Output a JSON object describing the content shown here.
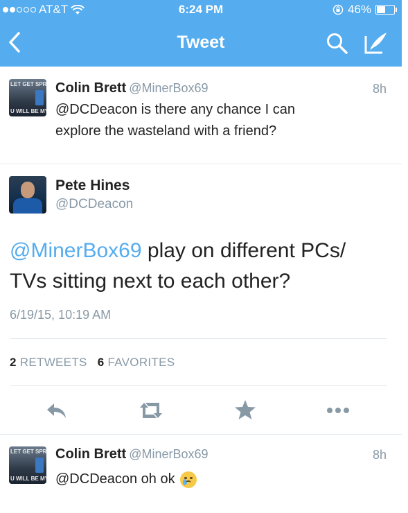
{
  "status_bar": {
    "carrier": "AT&T",
    "time": "6:24 PM",
    "battery": "46%"
  },
  "nav": {
    "title": "Tweet",
    "back_icon": "chevron-left-icon",
    "search_icon": "search-icon",
    "compose_icon": "compose-icon"
  },
  "reply_above": {
    "name": "Colin Brett",
    "handle": "@MinerBox69",
    "time": "8h",
    "text_line1": "@DCDeacon is there any chance I can",
    "text_line2": "explore the wasteland with a friend?",
    "avatar_text_top": "LET GET SPRINK",
    "avatar_text_bottom": "U WILL BE MY"
  },
  "main_tweet": {
    "name": "Pete Hines",
    "handle": "@DCDeacon",
    "mention": "@MinerBox69",
    "text_line1_rest": " play on different PCs/",
    "text_line2": "TVs sitting next to each other?",
    "timestamp": "6/19/15, 10:19 AM",
    "retweets_count": "2",
    "retweets_label": "RETWEETS",
    "favorites_count": "6",
    "favorites_label": "FAVORITES"
  },
  "actions": [
    "reply-icon",
    "retweet-icon",
    "favorite-icon",
    "more-icon"
  ],
  "reply_below": {
    "name": "Colin Brett",
    "handle": "@MinerBox69",
    "time": "8h",
    "text": "@DCDeacon oh ok",
    "avatar_text_top": "LET GET SPRINK",
    "avatar_text_bottom": "U WILL BE MY"
  },
  "watermark": "",
  "colors": {
    "brand": "#55acee",
    "text": "#222222",
    "muted": "#8899a6",
    "divider": "#e1e8ed"
  }
}
